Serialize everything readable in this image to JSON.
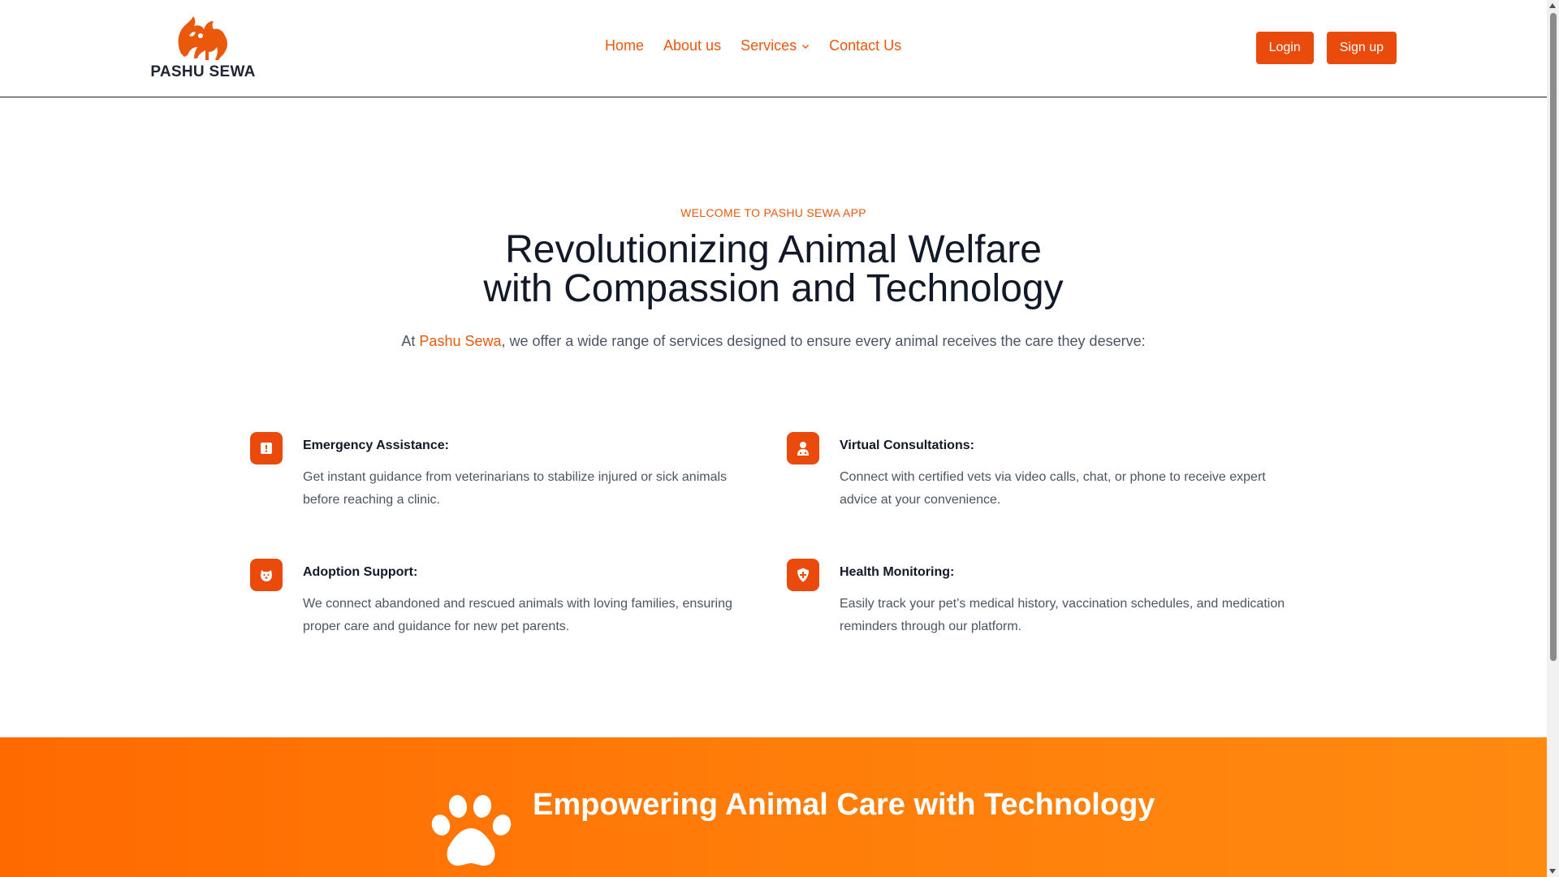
{
  "header": {
    "brand": "PASHU SEWA",
    "nav": [
      {
        "label": "Home"
      },
      {
        "label": "About us"
      },
      {
        "label": "Services"
      },
      {
        "label": "Contact Us"
      }
    ],
    "login_label": "Login",
    "signup_label": "Sign up"
  },
  "hero": {
    "eyebrow": "WELCOME TO PASHU SEWA APP",
    "headline_line1": "Revolutionizing Animal Welfare",
    "headline_line2": "with Compassion and Technology",
    "lede_prefix": "At ",
    "lede_brand": "Pashu Sewa",
    "lede_suffix": ", we offer a wide range of services designed to ensure every animal receives the care they deserve:"
  },
  "features": [
    {
      "icon": "alert-icon",
      "title": "Emergency Assistance:",
      "desc": "Get instant guidance from veterinarians to stabilize injured or sick animals before reaching a clinic."
    },
    {
      "icon": "doctor-icon",
      "title": "Virtual Consultations:",
      "desc": "Connect with certified vets via video calls, chat, or phone to receive expert advice at your convenience."
    },
    {
      "icon": "dog-icon",
      "title": "Adoption Support:",
      "desc": "We connect abandoned and rescued animals with loving families, ensuring proper care and guidance for new pet parents."
    },
    {
      "icon": "shield-plus-icon",
      "title": "Health Monitoring:",
      "desc": "Easily track your pet’s medical history, vaccination schedules, and medication reminders through our platform."
    }
  ],
  "banner": {
    "title": "Empowering Animal Care with Technology"
  },
  "colors": {
    "accent": "#ea580c",
    "button": "#ea4b0c",
    "banner_start": "#ff6a00",
    "banner_end": "#ff8a10"
  }
}
